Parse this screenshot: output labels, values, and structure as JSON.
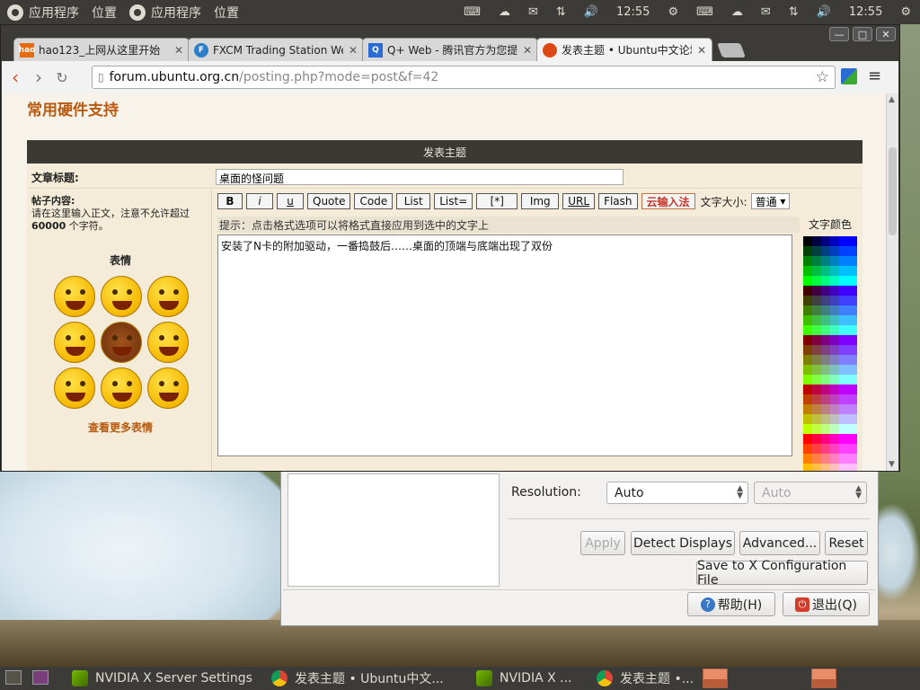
{
  "top_panel": {
    "menus": [
      "应用程序",
      "位置",
      "应用程序",
      "位置"
    ],
    "indicators": [
      "keyboard-icon",
      "cloud-icon",
      "mail-icon",
      "network-icon",
      "volume-icon"
    ],
    "time": [
      "12:55",
      "12:55"
    ]
  },
  "browser": {
    "tabs": [
      {
        "label": "hao123_上网从这里开始",
        "favicon": "hao"
      },
      {
        "label": "FXCM Trading Station Web",
        "favicon": "fxcm"
      },
      {
        "label": "Q+ Web - 腾讯官方为您提",
        "favicon": "Q"
      },
      {
        "label": "发表主题 • Ubuntu中文论坛",
        "favicon": "ubuntu"
      }
    ],
    "url_host": "forum.ubuntu.org.cn",
    "url_path": "/posting.php?mode=post&f=42",
    "page": {
      "site_title": "常用硬件支持",
      "post_header": "发表主题",
      "subject_label": "文章标题:",
      "subject_value": "桌面的怪问题",
      "content_label": "帖子内容:",
      "content_hint_1": "请在这里输入正文，注意不允许超过",
      "content_hint_bold": "60000",
      "content_hint_2": " 个字符。",
      "emoticons_label": "表情",
      "more_emoticons": "查看更多表情",
      "format_buttons": [
        "B",
        "i",
        "u",
        "Quote",
        "Code",
        "List",
        "List=",
        "[*]",
        "Img",
        "URL",
        "Flash"
      ],
      "ime_button": "云输入法",
      "font_size_label": "文字大小:",
      "font_size_value": "普通",
      "tip": "提示：点击格式选项可以将格式直接应用到选中的文字上",
      "body_text": "安装了N卡的附加驱动，一番捣鼓后……桌面的顶端与底端出现了双份",
      "text_color_label": "文字颜色"
    }
  },
  "nvidia": {
    "resolution_label": "Resolution:",
    "resolution_value": "Auto",
    "refresh_value": "Auto",
    "apply": "Apply",
    "detect": "Detect Displays",
    "advanced": "Advanced...",
    "reset": "Reset",
    "save": "Save to X Configuration File",
    "help": "帮助(H)",
    "quit": "退出(Q)"
  },
  "taskbar": {
    "items": [
      "NVIDIA X Server Settings",
      "发表主题 • Ubuntu中文...",
      "NVIDIA X ...",
      "发表主题 •..."
    ]
  },
  "colors": {
    "panel": "#3c3b37",
    "accent_orange": "#b85a10",
    "post_header_bg": "#3c3932"
  }
}
